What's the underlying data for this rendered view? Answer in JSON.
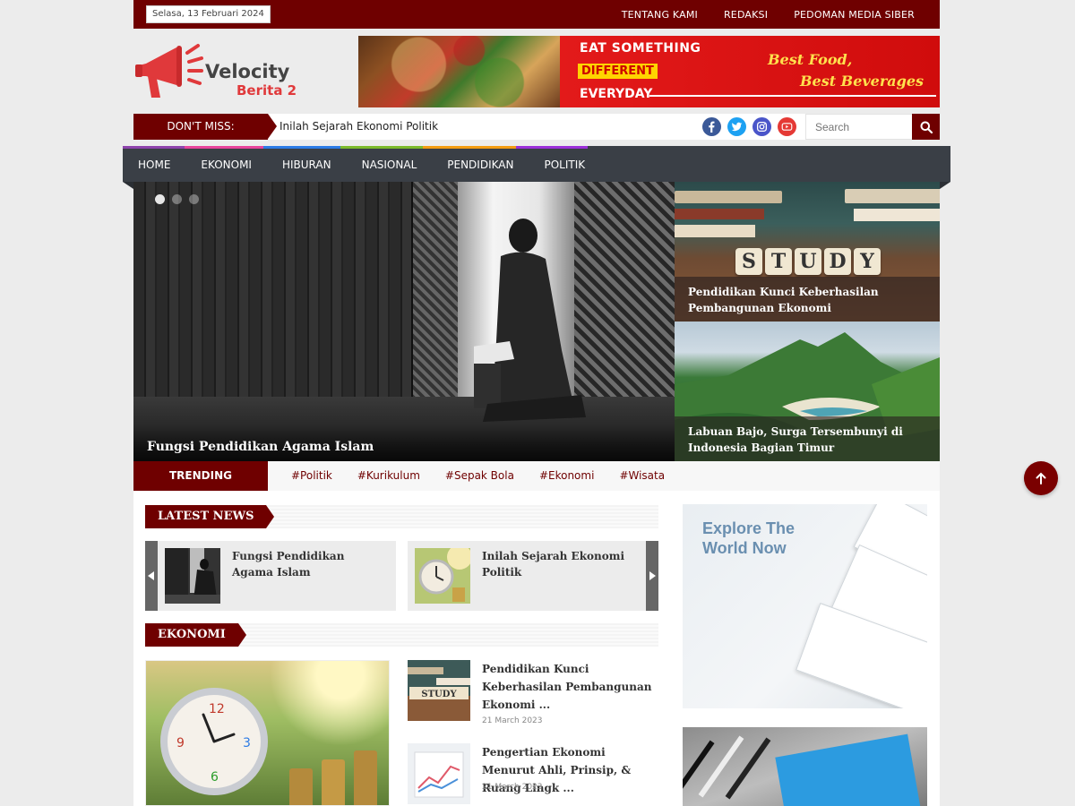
{
  "topbar": {
    "date": "Selasa, 13 Februari 2024",
    "links": [
      "TENTANG KAMI",
      "REDAKSI",
      "PEDOMAN MEDIA SIBER"
    ]
  },
  "logo": {
    "line1": "Velocity",
    "line2": "Berita 2"
  },
  "banner": {
    "line1": "EAT SOMETHING",
    "line2": "DIFFERENT",
    "line3": "EVERYDAY",
    "slogan1": "Best Food,",
    "slogan2": "Best Beverages"
  },
  "dont_miss": {
    "label": "DON'T MISS:",
    "headline": "Inilah Sejarah Ekonomi Politik"
  },
  "social": [
    "facebook-icon",
    "twitter-icon",
    "instagram-icon",
    "youtube-icon"
  ],
  "search": {
    "placeholder": "Search"
  },
  "nav": {
    "items": [
      "HOME",
      "EKONOMI",
      "HIBURAN",
      "NASIONAL",
      "PENDIDIKAN",
      "POLITIK"
    ],
    "stripe_colors": [
      "#8e44ad",
      "#555a60",
      "#e8459c",
      "#2c7be5",
      "#7cbb2c",
      "#f39c12",
      "#9b30d9"
    ]
  },
  "hero": {
    "main_title": "Fungsi Pendidikan Agama Islam",
    "side": [
      {
        "title": "Pendidikan Kunci Keberhasilan Pembangunan Ekonomi"
      },
      {
        "title": "Labuan Bajo, Surga Tersembunyi di Indonesia Bagian Timur"
      }
    ],
    "tiles": [
      "S",
      "T",
      "U",
      "D",
      "Y"
    ]
  },
  "trending": {
    "label": "TRENDING",
    "tags": [
      "#Politik",
      "#Kurikulum",
      "#Sepak Bola",
      "#Ekonomi",
      "#Wisata"
    ]
  },
  "latest_news": {
    "heading": "LATEST NEWS",
    "items": [
      {
        "title": "Fungsi Pendidikan Agama Islam"
      },
      {
        "title": "Inilah Sejarah Ekonomi Politik"
      }
    ]
  },
  "ekonomi": {
    "heading": "EKONOMI",
    "items": [
      {
        "title": "Pendidikan Kunci Keberhasilan Pembangunan Ekonomi ...",
        "date": "21 March 2023"
      },
      {
        "title": "Pengertian Ekonomi Menurut Ahli, Prinsip, & Ruang Lingk ...",
        "date": "21 March 2023"
      }
    ],
    "thumb_label": "STUDY"
  },
  "ad": {
    "text": "Explore The World Now"
  },
  "colors": {
    "brand": "#6f0000",
    "nav": "#3a3f46"
  }
}
